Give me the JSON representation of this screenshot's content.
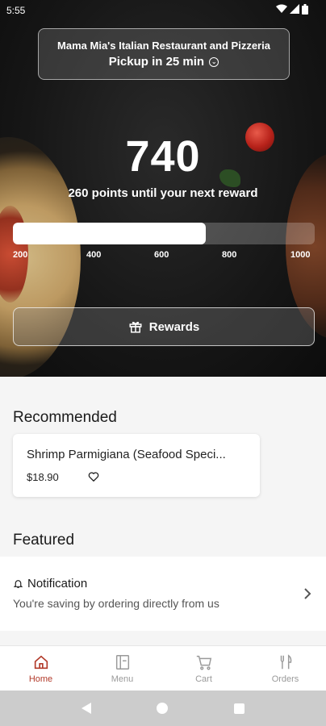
{
  "status": {
    "time": "5:55"
  },
  "store": {
    "name": "Mama Mia's Italian Restaurant and Pizzeria",
    "pickup": "Pickup in 25 min"
  },
  "loyalty": {
    "points": "740",
    "subtitle": "260 points until your next reward",
    "progress_fraction": 0.64,
    "ticks": [
      "200",
      "400",
      "600",
      "800",
      "1000"
    ],
    "rewards_label": "Rewards"
  },
  "recommended": {
    "title": "Recommended",
    "item": {
      "name": "Shrimp Parmigiana (Seafood Speci...",
      "price": "$18.90"
    }
  },
  "featured": {
    "title": "Featured",
    "notification_title": "Notification",
    "notification_text": "You're saving by ordering directly from us"
  },
  "tabs": [
    {
      "label": "Home",
      "icon": "home-icon",
      "active": true
    },
    {
      "label": "Menu",
      "icon": "menu-icon",
      "active": false
    },
    {
      "label": "Cart",
      "icon": "cart-icon",
      "active": false
    },
    {
      "label": "Orders",
      "icon": "orders-icon",
      "active": false
    }
  ],
  "colors": {
    "accent": "#b23a2a",
    "hero_bg": "#161616"
  }
}
